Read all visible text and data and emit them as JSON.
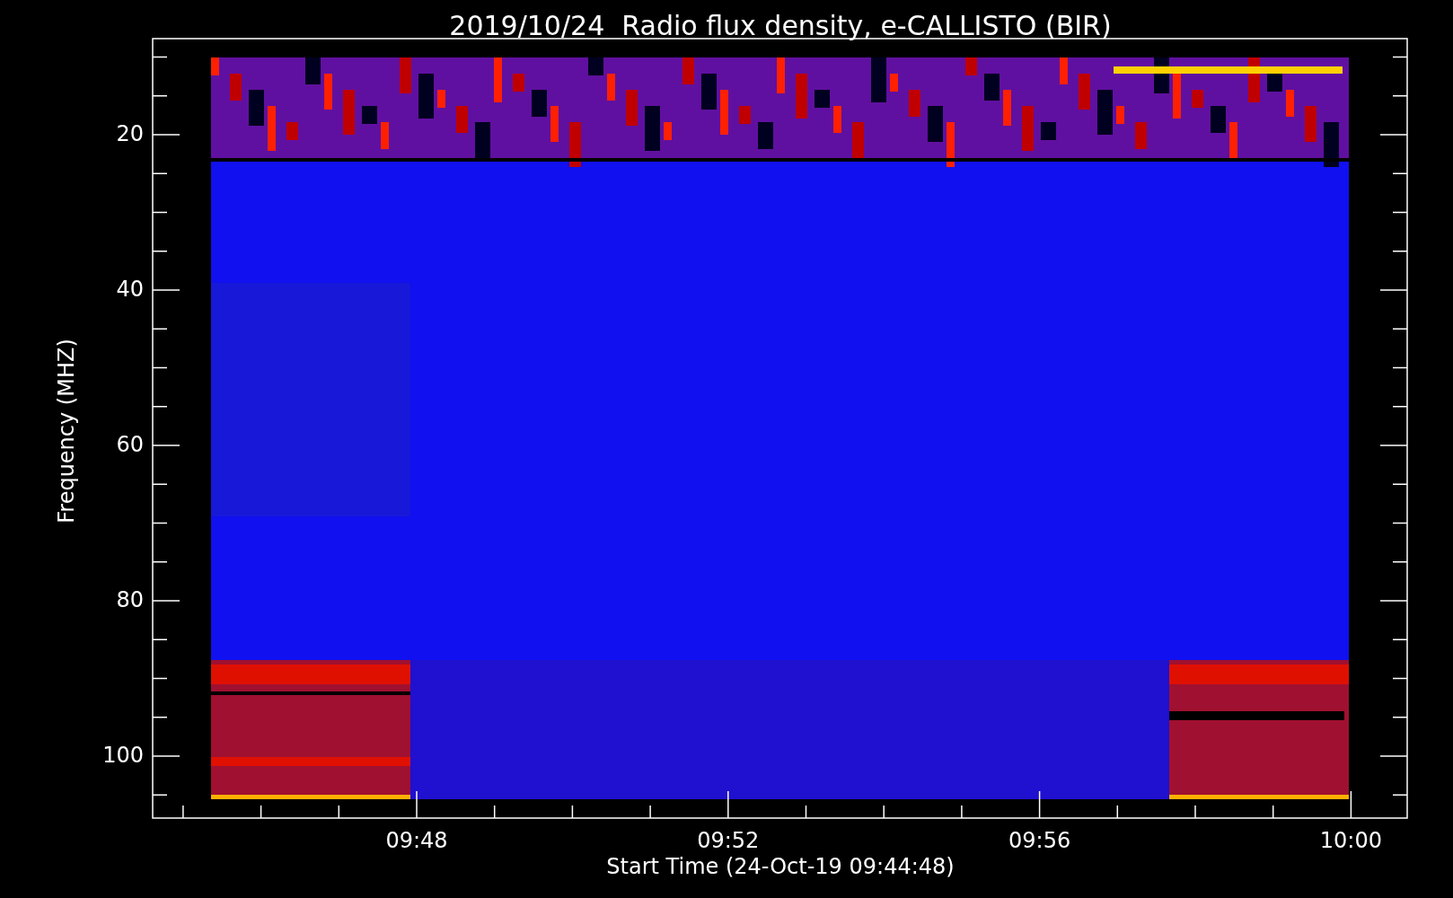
{
  "title": "2019/10/24  Radio flux density, e-CALLISTO (BIR)",
  "y_axis": {
    "label": "Frequency (MHZ)",
    "tick_labels": [
      "20",
      "40",
      "60",
      "80",
      "100"
    ]
  },
  "x_axis": {
    "label": "Start Time (24-Oct-19 09:44:48)",
    "tick_labels": [
      "09:48",
      "09:52",
      "09:56",
      "10:00"
    ]
  }
}
